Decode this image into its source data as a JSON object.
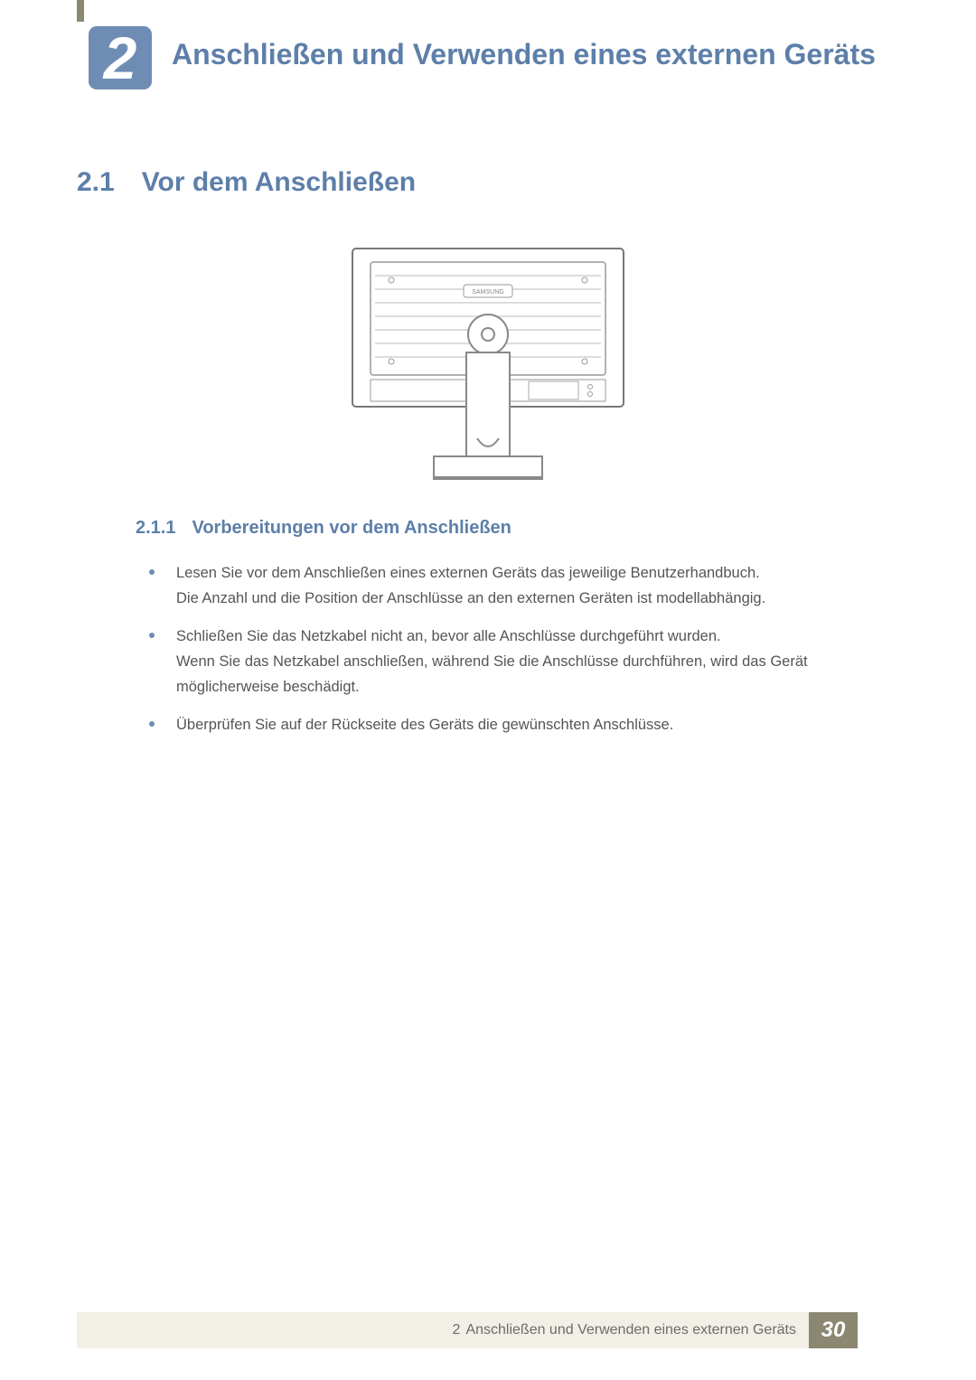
{
  "chapter": {
    "number": "2",
    "title": "Anschließen und Verwenden eines externen Geräts"
  },
  "section": {
    "number": "2.1",
    "title": "Vor dem Anschließen"
  },
  "subsection": {
    "number": "2.1.1",
    "title": "Vorbereitungen vor dem Anschließen"
  },
  "bullets": [
    {
      "main": "Lesen Sie vor dem Anschließen eines externen Geräts das jeweilige Benutzerhandbuch.",
      "sub": "Die Anzahl und die Position der Anschlüsse an den externen Geräten ist modellabhängig."
    },
    {
      "main": "Schließen Sie das Netzkabel nicht an, bevor alle Anschlüsse durchgeführt wurden.",
      "sub": "Wenn Sie das Netzkabel anschließen, während Sie die Anschlüsse durchführen, wird das Gerät möglicherweise beschädigt."
    },
    {
      "main": "Überprüfen Sie auf der Rückseite des Geräts die gewünschten Anschlüsse.",
      "sub": ""
    }
  ],
  "figure": {
    "brand_label": "SAMSUNG"
  },
  "footer": {
    "chapter_ref": "2",
    "title": "Anschließen und Verwenden eines externen Geräts",
    "page_number": "30"
  }
}
